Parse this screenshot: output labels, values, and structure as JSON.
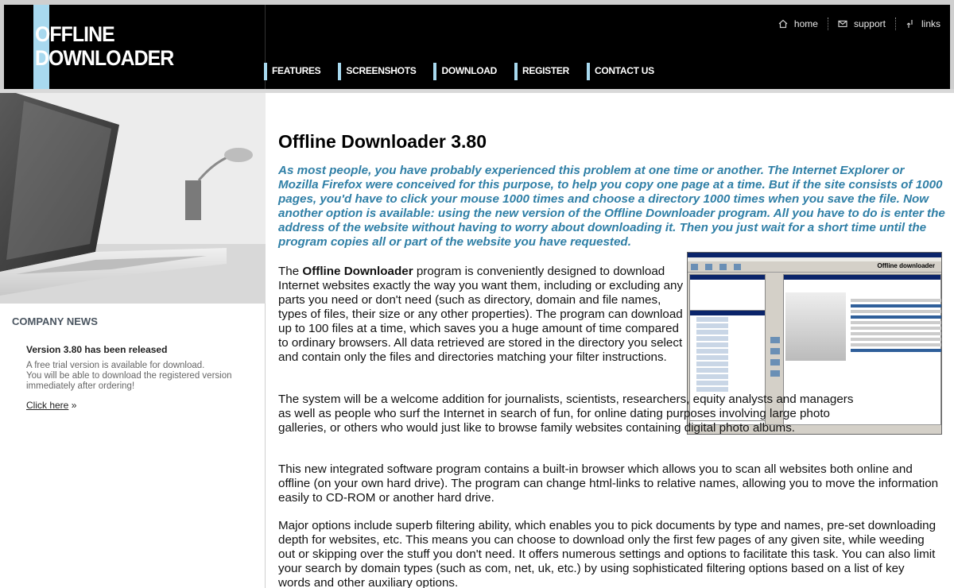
{
  "brand": {
    "line1": "OFFLINE",
    "line2": "DOWNLOADER"
  },
  "utility_nav": [
    {
      "label": "home",
      "icon": "home-icon"
    },
    {
      "label": "support",
      "icon": "envelope-icon"
    },
    {
      "label": "links",
      "icon": "link-icon"
    }
  ],
  "main_nav": [
    {
      "label": "FEATURES"
    },
    {
      "label": "SCREENSHOTS"
    },
    {
      "label": "DOWNLOAD"
    },
    {
      "label": "REGISTER"
    },
    {
      "label": "CONTACT US"
    }
  ],
  "sidebar": {
    "news_title": "COMPANY NEWS",
    "news_headline": "Version 3.80 has been released",
    "news_body_1": "A free trial version is available for download.",
    "news_body_2": "You will be able to download the registered version immediately after ordering!",
    "link_text": "Click here",
    "link_suffix": "»"
  },
  "main": {
    "title": "Offline Downloader 3.80",
    "intro": "As most people, you have probably experienced this problem at one time or another. The Internet Explorer or Mozilla Firefox were conceived for this purpose, to help you copy one page at a time. But if the site consists of 1000 pages, you'd have to click your mouse 1000 times and choose a directory 1000 times when you save the file. Now another option is available: using the new version of the Offline Downloader  program. All you have to do is enter the address of the website without having to worry about downloading it. Then you just wait for a short time until the program copies all or part of the website you have requested.",
    "p1_before": "The ",
    "p1_bold": "Offline Downloader",
    "p1_after": " program is conveniently designed to download Internet websites exactly the way you want them, including or excluding any parts you need or don't need (such as directory, domain and file names, types of files, their size or any other properties). The program can download up to 100 files at a time, which saves you a huge amount of time compared to ordinary browsers. All data retrieved are stored in the directory you select and contain only the files and directories matching your filter instructions.",
    "p2": "The system will be a welcome addition for journalists, scientists, researchers, equity analysts and managers as well as people who surf the Internet in search of fun, for online dating purposes involving large photo galleries, or others who would just like to browse family websites containing digital photo albums.",
    "p3": "This new integrated software program contains a built-in browser which allows you to scan all websites both online and offline (on your own hard drive). The program can change html-links to relative names, allowing you to move the information easily to CD-ROM or another hard drive.",
    "p4": "Major options include superb filtering ability, which enables you to pick documents by type and names, pre-set downloading depth for websites, etc. This means you can choose to download only the first few pages of any given site, while weeding out or skipping over the stuff you don't need.   It offers numerous settings and options to facilitate this task. You can also limit your search by domain types (such as com, net, uk, etc.) by using sophisticated filtering options based on a list of key words and other auxiliary options.",
    "screenshot_brand": "Offline downloader"
  },
  "colors": {
    "accent": "#a8d9ef",
    "intro_text": "#2f7fa6",
    "header_bg": "#000000"
  }
}
